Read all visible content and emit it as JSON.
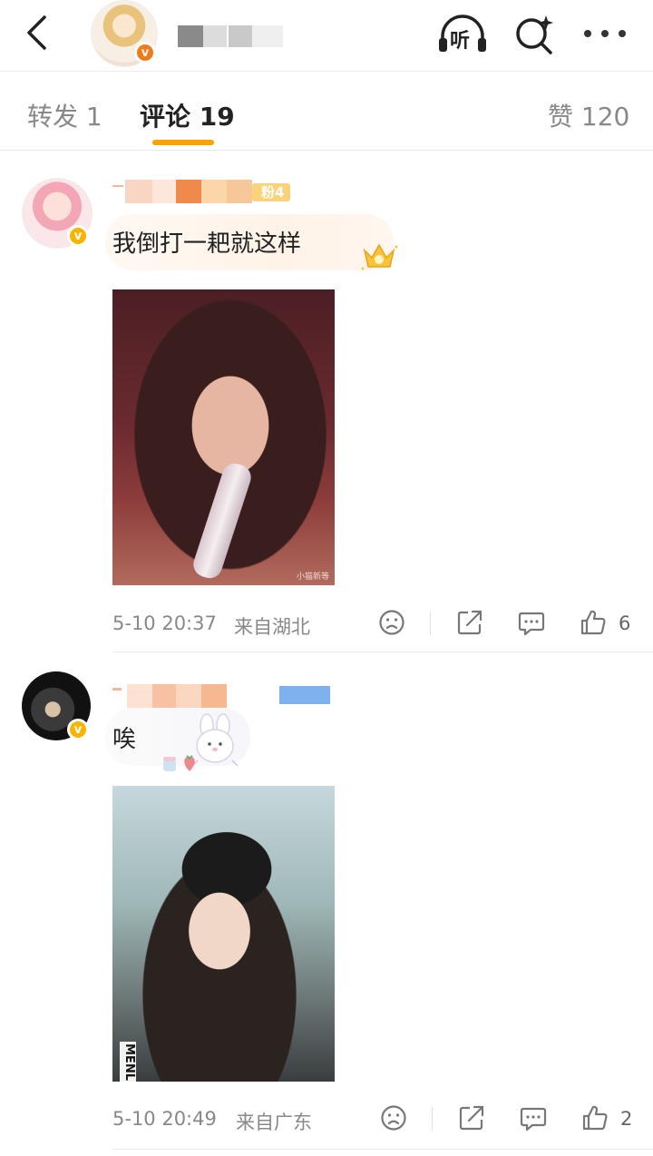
{
  "header": {
    "back_icon": "chevron-left-icon",
    "listen_label": "听",
    "search_icon": "search-sparkle-icon",
    "more_icon": "more-dots-icon"
  },
  "tabs": [
    {
      "label": "转发 1",
      "active": false
    },
    {
      "label": "评论 19",
      "active": true
    },
    {
      "label": "赞 120",
      "active": false
    }
  ],
  "accent_color": "#f7a300",
  "comments": [
    {
      "badge_label": "粉4",
      "text": "我倒打一耙就这样",
      "time": "5-10 20:37",
      "location": "来自湖北",
      "likes": "6",
      "watermark": "小猫新等"
    },
    {
      "text": "唉",
      "time": "5-10 20:49",
      "location": "来自广东",
      "likes": "2",
      "photo_sign": "MENL"
    }
  ]
}
